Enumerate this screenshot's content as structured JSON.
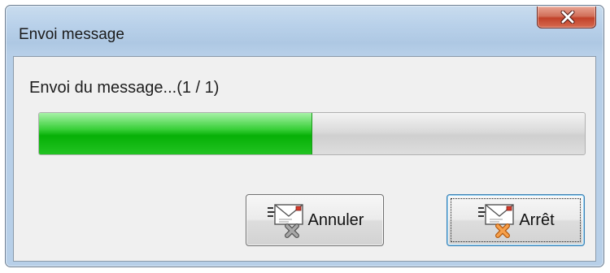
{
  "window": {
    "title": "Envoi message"
  },
  "titlebar": {
    "close_icon": "close-x-icon"
  },
  "status": {
    "text": "Envoi du message...(1 / 1)"
  },
  "progress": {
    "fraction": 0.5,
    "color": "#0ab00a"
  },
  "buttons": {
    "cancel": {
      "label": "Annuler",
      "icon": "mail-cancel-icon",
      "badge_color": "#8a8a8a"
    },
    "stop": {
      "label": "Arrêt",
      "icon": "mail-stop-icon",
      "badge_color": "#f08a2a"
    }
  }
}
